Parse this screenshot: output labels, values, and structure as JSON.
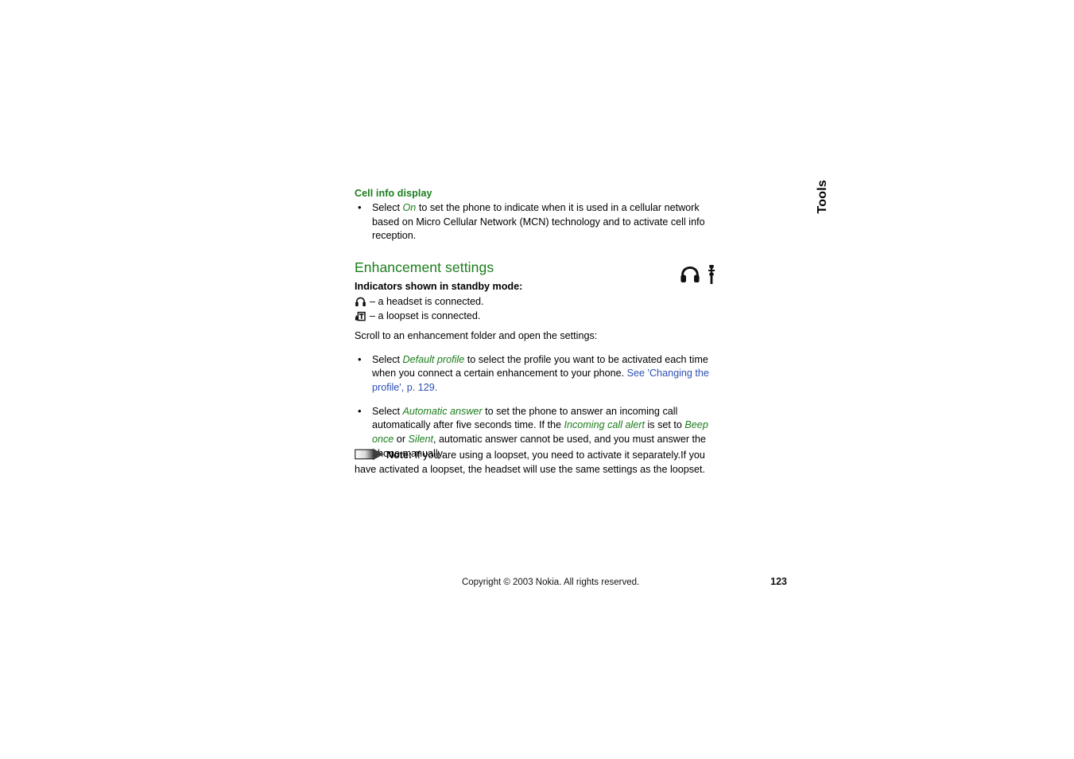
{
  "page": {
    "side_tab_label": "Tools",
    "colors": {
      "heading_green": "#1a7d1a",
      "link_blue": "#2d4fb5",
      "text_black": "#000000",
      "page_background": "#ffffff"
    }
  },
  "cell_info": {
    "heading": "Cell info display",
    "bullet": {
      "lead": "Select ",
      "emphasis": "On",
      "rest": " to set the phone to indicate when it is used in a cellular network based on Micro Cellular Network (MCN) technology and to activate cell info reception."
    }
  },
  "enhancement": {
    "heading": "Enhancement settings",
    "indicators_intro": "Indicators shown in standby mode:",
    "indicators": [
      {
        "icon": "headset-icon",
        "text": "– a headset is connected."
      },
      {
        "icon": "loopset-icon",
        "text": "– a loopset is connected."
      }
    ],
    "scroll_line": "Scroll to an enhancement folder and open the settings:",
    "bullets": [
      {
        "lead": "Select ",
        "emphasis": "Default profile",
        "middle": " to select the profile you want to be activated each time when you connect a certain enhancement to your phone. ",
        "link": "See 'Changing the profile', p. 129."
      },
      {
        "lead": "Select ",
        "emphasis": "Automatic answer",
        "middle": " to set the phone to answer an incoming call automatically after five seconds time. If the ",
        "emphasis2": "Incoming call alert",
        "middle2": " is set to ",
        "emphasis3": "Beep once",
        "middle3": " or ",
        "emphasis4": "Silent",
        "tail": ", automatic answer cannot be used, and you must answer the phone manually."
      }
    ],
    "header_icons": [
      {
        "name": "headset-icon"
      },
      {
        "name": "wrench-tool-icon"
      }
    ]
  },
  "note": {
    "icon": "arrow-right-note-icon",
    "label": "Note:",
    "text": " If you are using a loopset, you need to activate it separately.If you have activated a loopset, the headset will use the same settings as the loopset."
  },
  "footer": {
    "copyright": "Copyright © 2003 Nokia. All rights reserved.",
    "page_number": "123"
  }
}
